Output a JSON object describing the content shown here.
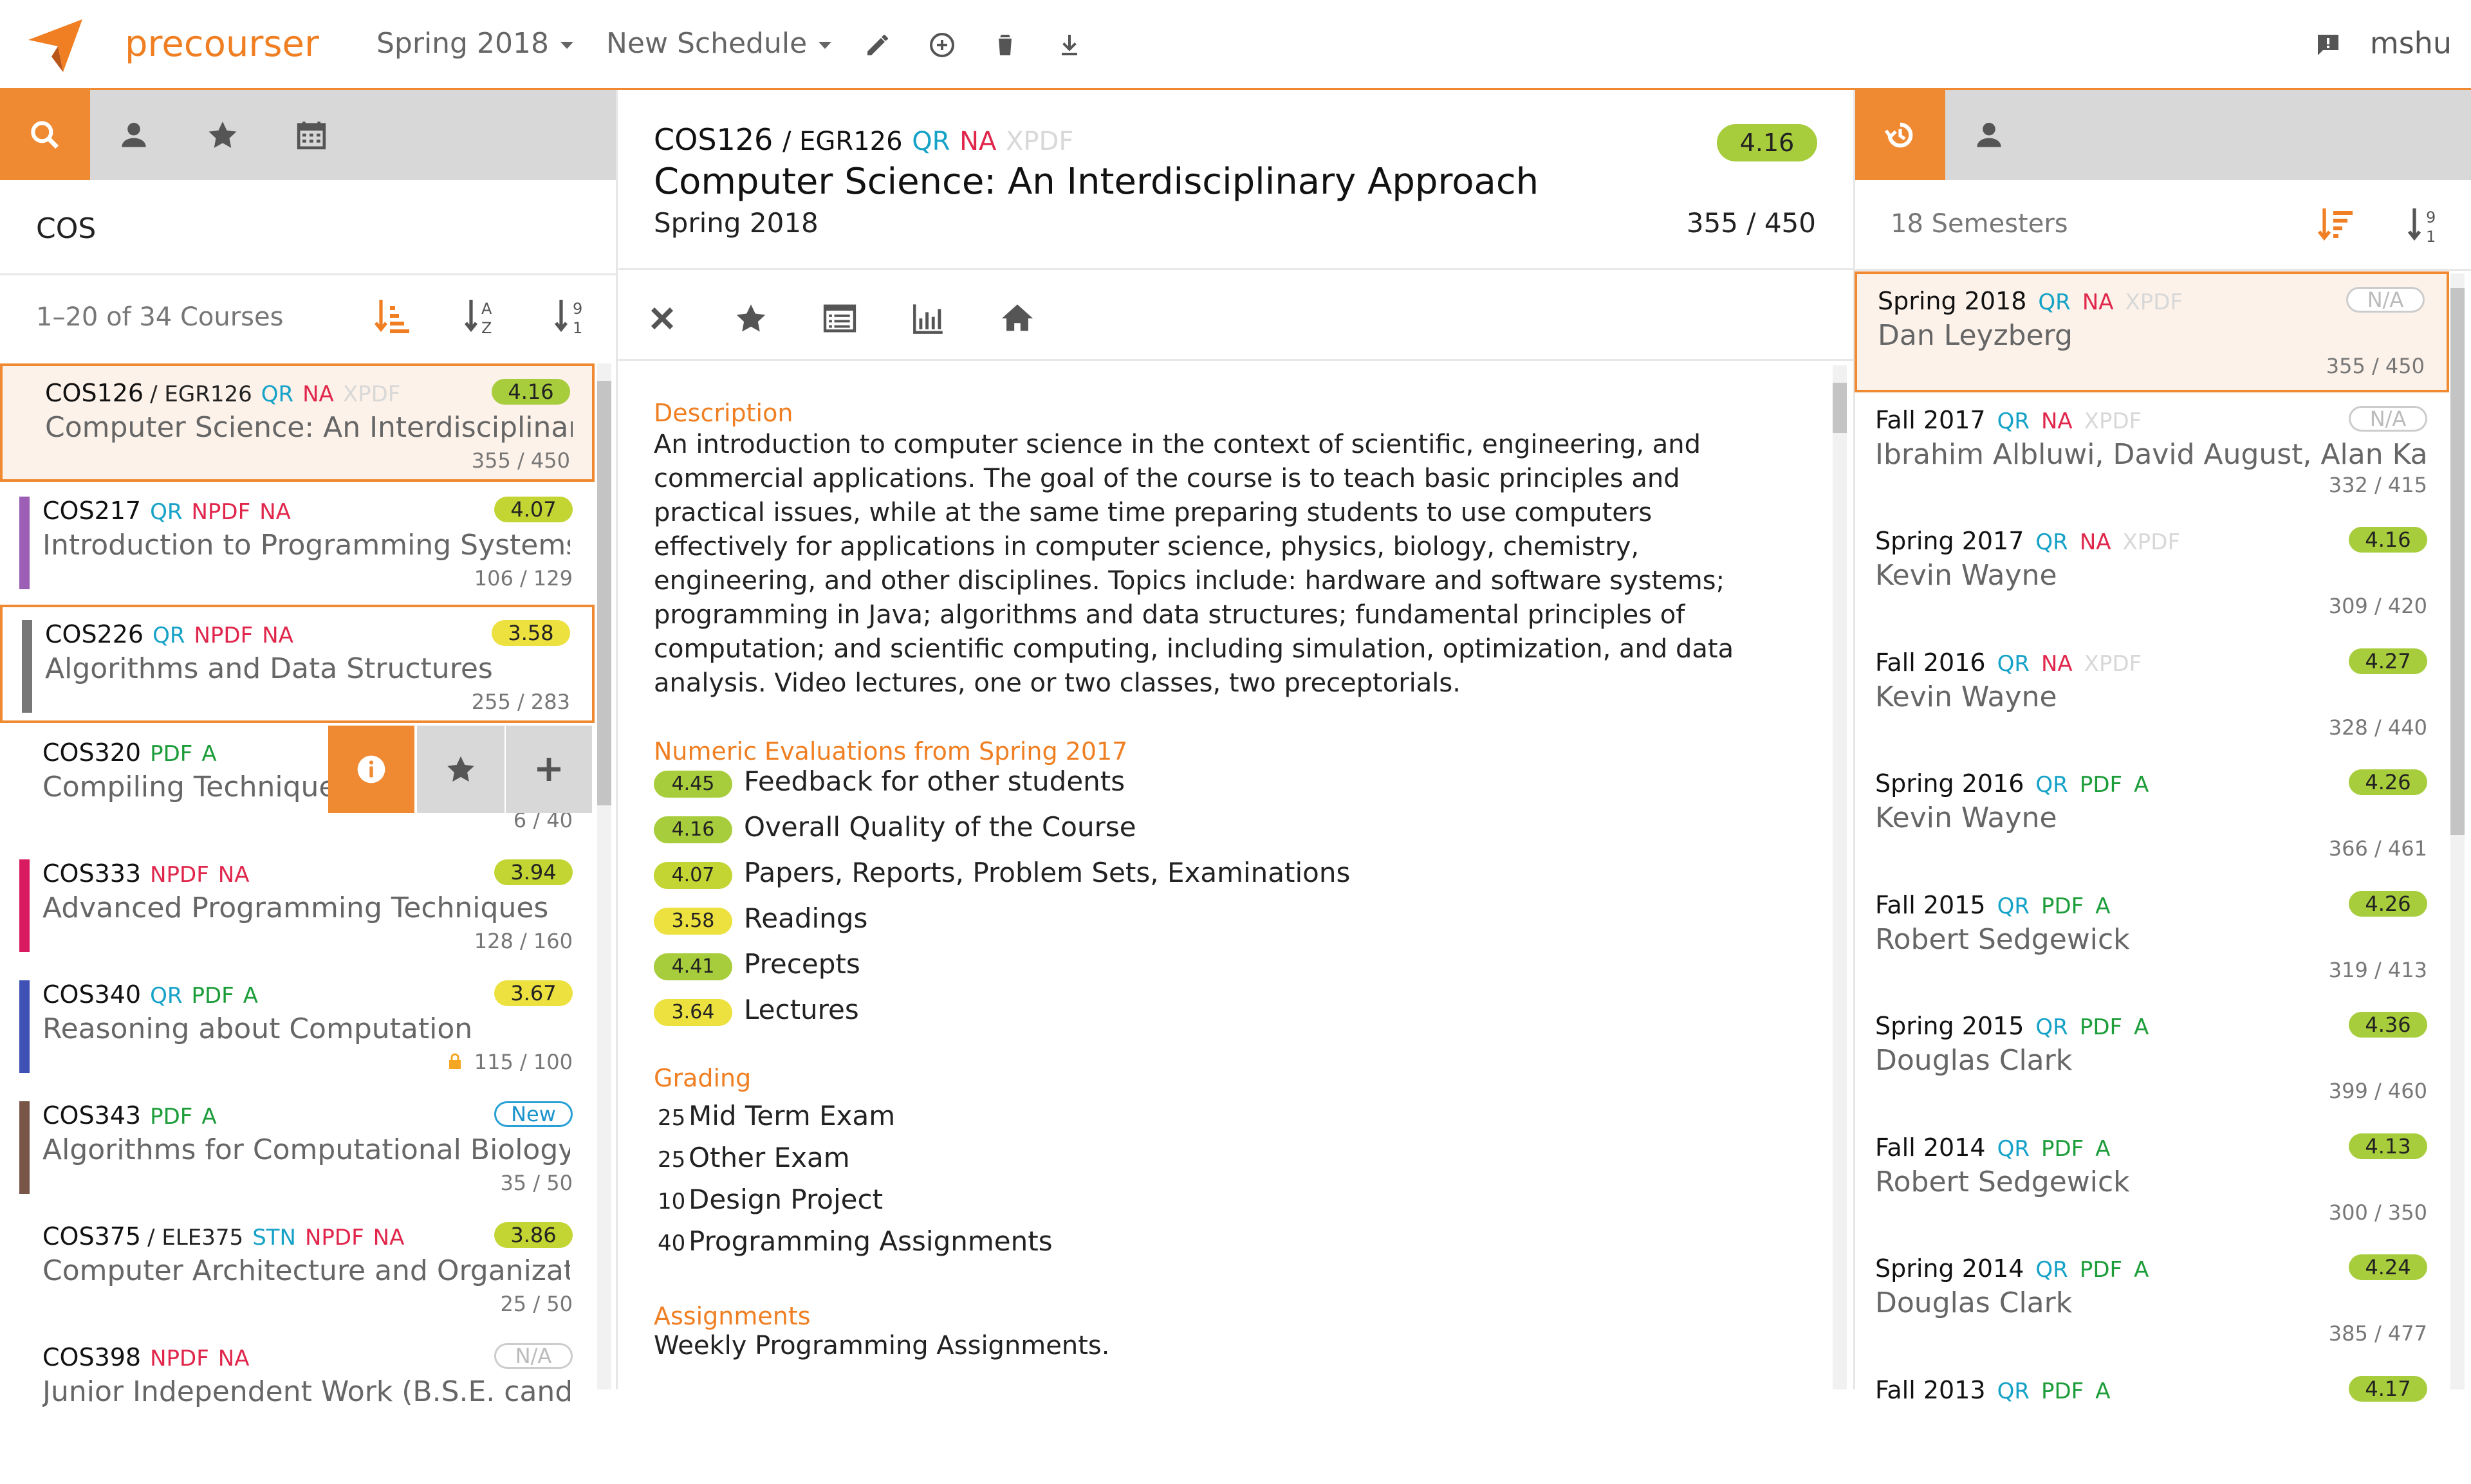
{
  "nav": {
    "brand": "precourser",
    "semester": "Spring 2018",
    "schedule": "New Schedule",
    "user": "mshu",
    "tools": [
      "edit-icon",
      "add-circle-icon",
      "trash-icon",
      "download-icon"
    ],
    "feedback_icon": "feedback-icon"
  },
  "colors": {
    "accent": "#ef8a33",
    "qr": "#16a2c7",
    "na": "#e0264b",
    "pdf": "#1d9d3a",
    "rating_green": "#a8cd3c",
    "rating_yellow": "#dfe03a"
  },
  "left": {
    "tabs": [
      "search-icon",
      "user-icon",
      "star-icon",
      "calendar-icon"
    ],
    "search_value": "COS",
    "count": "1–20 of 34 Courses",
    "courses": [
      {
        "code": "COS126",
        "cross": "/ EGR126",
        "tags": [
          [
            "QR",
            "qr"
          ],
          [
            "NA",
            "na"
          ],
          [
            "XPDF",
            "xpdf"
          ]
        ],
        "title": "Computer Science: An Interdisciplinar...",
        "rating": "4.16",
        "enroll": "355 / 450",
        "color": "",
        "badge": "g1"
      },
      {
        "code": "COS217",
        "cross": "",
        "tags": [
          [
            "QR",
            "qr"
          ],
          [
            "NPDF",
            "na"
          ],
          [
            "NA",
            "na"
          ]
        ],
        "title": "Introduction to Programming Systems",
        "rating": "4.07",
        "enroll": "106 / 129",
        "color": "#9c5fb5",
        "badge": "g2"
      },
      {
        "code": "COS226",
        "cross": "",
        "tags": [
          [
            "QR",
            "qr"
          ],
          [
            "NPDF",
            "na"
          ],
          [
            "NA",
            "na"
          ]
        ],
        "title": "Algorithms and Data Structures",
        "rating": "3.58",
        "enroll": "255 / 283",
        "color": "#777777",
        "badge": "y2"
      },
      {
        "code": "COS320",
        "cross": "",
        "tags": [
          [
            "PDF",
            "pdf"
          ],
          [
            "A",
            "pdf"
          ]
        ],
        "title": "Compiling Techniques",
        "rating": "",
        "enroll": "6 / 40",
        "color": "",
        "badge": ""
      },
      {
        "code": "COS333",
        "cross": "",
        "tags": [
          [
            "NPDF",
            "na"
          ],
          [
            "NA",
            "na"
          ]
        ],
        "title": "Advanced Programming Techniques",
        "rating": "3.94",
        "enroll": "128 / 160",
        "color": "#d81b60",
        "badge": "g2"
      },
      {
        "code": "COS340",
        "cross": "",
        "tags": [
          [
            "QR",
            "qr"
          ],
          [
            "PDF",
            "pdf"
          ],
          [
            "A",
            "pdf"
          ]
        ],
        "title": "Reasoning about Computation",
        "rating": "3.67",
        "enroll": "115 / 100",
        "color": "#3f51b5",
        "badge": "y2"
      },
      {
        "code": "COS343",
        "cross": "",
        "tags": [
          [
            "PDF",
            "pdf"
          ],
          [
            "A",
            "pdf"
          ]
        ],
        "title": "Algorithms for Computational Biology",
        "rating": "New",
        "enroll": "35 / 50",
        "color": "#795548",
        "badge": "b-new"
      },
      {
        "code": "COS375",
        "cross": "/ ELE375",
        "tags": [
          [
            "STN",
            "stn"
          ],
          [
            "NPDF",
            "na"
          ],
          [
            "NA",
            "na"
          ]
        ],
        "title": "Computer Architecture and Organizat...",
        "rating": "3.86",
        "enroll": "25 / 50",
        "color": "",
        "badge": "g2"
      },
      {
        "code": "COS398",
        "cross": "",
        "tags": [
          [
            "NPDF",
            "na"
          ],
          [
            "NA",
            "na"
          ]
        ],
        "title": "Junior Independent Work (B.S.E. cand...",
        "rating": "N/A",
        "enroll": "",
        "color": "",
        "badge": "b-na"
      }
    ]
  },
  "center": {
    "code": "COS126",
    "cross": "/ EGR126",
    "tags": [
      "QR",
      "NA",
      "XPDF"
    ],
    "title": "Computer Science: An Interdisciplinary Approach",
    "term": "Spring 2018",
    "enroll": "355 / 450",
    "rating": "4.16",
    "tools": [
      "close-icon",
      "star-icon",
      "syllabus-icon",
      "chart-icon",
      "home-icon"
    ],
    "description_head": "Description",
    "description": "An introduction to computer science in the context of scientific, engineering, and commercial applications. The goal of the course is to teach basic principles and practical issues, while at the same time preparing students to use computers effectively for applications in computer science, physics, biology, chemistry, engineering, and other disciplines. Topics include: hardware and software systems; programming in Java; algorithms and data structures; fundamental principles of computation; and scientific computing, including simulation, optimization, and data analysis. Video lectures, one or two classes, two preceptorials.",
    "eval_head": "Numeric Evaluations from Spring 2017",
    "evals": [
      {
        "score": "4.45",
        "label": "Feedback for other students",
        "cls": "g1"
      },
      {
        "score": "4.16",
        "label": "Overall Quality of the Course",
        "cls": "g1"
      },
      {
        "score": "4.07",
        "label": "Papers, Reports, Problem Sets, Examinations",
        "cls": "g2"
      },
      {
        "score": "3.58",
        "label": "Readings",
        "cls": "y2"
      },
      {
        "score": "4.41",
        "label": "Precepts",
        "cls": "g1"
      },
      {
        "score": "3.64",
        "label": "Lectures",
        "cls": "y2"
      }
    ],
    "grading_head": "Grading",
    "grading": [
      {
        "pct": "25",
        "label": "Mid Term Exam"
      },
      {
        "pct": "25",
        "label": "Other Exam"
      },
      {
        "pct": "10",
        "label": "Design Project"
      },
      {
        "pct": "40",
        "label": "Programming Assignments"
      }
    ],
    "assign_head": "Assignments",
    "assign": "Weekly Programming Assignments."
  },
  "right": {
    "tabs": [
      "history-icon",
      "user-icon"
    ],
    "count": "18 Semesters",
    "semesters": [
      {
        "term": "Spring 2018",
        "tags": [
          [
            "QR",
            "qr"
          ],
          [
            "NA",
            "na"
          ],
          [
            "XPDF",
            "xpdf"
          ]
        ],
        "inst": "Dan Leyzberg",
        "rating": "N/A",
        "enroll": "355 / 450",
        "badge": "b-na"
      },
      {
        "term": "Fall 2017",
        "tags": [
          [
            "QR",
            "qr"
          ],
          [
            "NA",
            "na"
          ],
          [
            "XPDF",
            "xpdf"
          ]
        ],
        "inst": "Ibrahim Albluwi, David August, Alan Ka...",
        "rating": "N/A",
        "enroll": "332 / 415",
        "badge": "b-na"
      },
      {
        "term": "Spring 2017",
        "tags": [
          [
            "QR",
            "qr"
          ],
          [
            "NA",
            "na"
          ],
          [
            "XPDF",
            "xpdf"
          ]
        ],
        "inst": "Kevin Wayne",
        "rating": "4.16",
        "enroll": "309 / 420",
        "badge": "g1"
      },
      {
        "term": "Fall 2016",
        "tags": [
          [
            "QR",
            "qr"
          ],
          [
            "NA",
            "na"
          ],
          [
            "XPDF",
            "xpdf"
          ]
        ],
        "inst": "Kevin Wayne",
        "rating": "4.27",
        "enroll": "328 / 440",
        "badge": "g1"
      },
      {
        "term": "Spring 2016",
        "tags": [
          [
            "QR",
            "qr"
          ],
          [
            "PDF",
            "pdf"
          ],
          [
            "A",
            "pdf"
          ]
        ],
        "inst": "Kevin Wayne",
        "rating": "4.26",
        "enroll": "366 / 461",
        "badge": "g1"
      },
      {
        "term": "Fall 2015",
        "tags": [
          [
            "QR",
            "qr"
          ],
          [
            "PDF",
            "pdf"
          ],
          [
            "A",
            "pdf"
          ]
        ],
        "inst": "Robert Sedgewick",
        "rating": "4.26",
        "enroll": "319 / 413",
        "badge": "g1"
      },
      {
        "term": "Spring 2015",
        "tags": [
          [
            "QR",
            "qr"
          ],
          [
            "PDF",
            "pdf"
          ],
          [
            "A",
            "pdf"
          ]
        ],
        "inst": "Douglas Clark",
        "rating": "4.36",
        "enroll": "399 / 460",
        "badge": "g1"
      },
      {
        "term": "Fall 2014",
        "tags": [
          [
            "QR",
            "qr"
          ],
          [
            "PDF",
            "pdf"
          ],
          [
            "A",
            "pdf"
          ]
        ],
        "inst": "Robert Sedgewick",
        "rating": "4.13",
        "enroll": "300 / 350",
        "badge": "g1"
      },
      {
        "term": "Spring 2014",
        "tags": [
          [
            "QR",
            "qr"
          ],
          [
            "PDF",
            "pdf"
          ],
          [
            "A",
            "pdf"
          ]
        ],
        "inst": "Douglas Clark",
        "rating": "4.24",
        "enroll": "385 / 477",
        "badge": "g1"
      },
      {
        "term": "Fall 2013",
        "tags": [
          [
            "QR",
            "qr"
          ],
          [
            "PDF",
            "pdf"
          ],
          [
            "A",
            "pdf"
          ]
        ],
        "inst": "",
        "rating": "4.17",
        "enroll": "",
        "badge": "g1"
      }
    ]
  },
  "popover": {
    "icons": [
      "info-icon",
      "star-icon",
      "plus-icon"
    ]
  }
}
